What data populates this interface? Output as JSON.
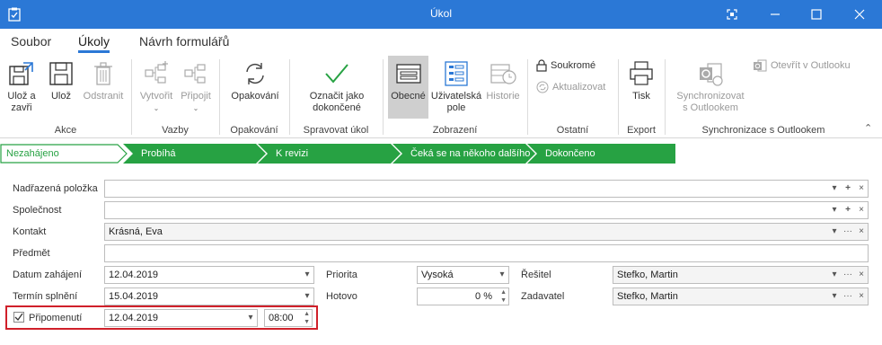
{
  "window": {
    "title": "Úkol",
    "buttons": [
      "focus-icon",
      "minimize-icon",
      "maximize-icon",
      "close-icon"
    ]
  },
  "tabs": [
    {
      "label": "Soubor",
      "active": false
    },
    {
      "label": "Úkoly",
      "active": true
    },
    {
      "label": "Návrh formulářů",
      "active": false
    }
  ],
  "ribbon": {
    "groups": {
      "akce": "Akce",
      "vazby": "Vazby",
      "opakovani": "Opakování",
      "spravovat": "Spravovat úkol",
      "zobrazeni": "Zobrazení",
      "ostatni": "Ostatní",
      "export": "Export",
      "sync": "Synchronizace s Outlookem"
    },
    "buttons": {
      "uloz_zavri_1": "Ulož a",
      "uloz_zavri_2": "zavři",
      "uloz": "Ulož",
      "odstranit": "Odstranit",
      "vytvorit": "Vytvořit",
      "pripojit": "Připojit",
      "opakovani": "Opakování",
      "oznacit_1": "Označit jako",
      "oznacit_2": "dokončené",
      "obecne": "Obecné",
      "uziv_1": "Uživatelská",
      "uziv_2": "pole",
      "historie": "Historie",
      "soukrome": "Soukromé",
      "aktualizovat": "Aktualizovat",
      "tisk": "Tisk",
      "sync_1": "Synchronizovat",
      "sync_2": "s Outlookem",
      "otevrit": "Otevřít v Outlooku"
    },
    "colors": {
      "accent": "#2b78d6",
      "disabled": "#9a9a9a"
    }
  },
  "stages": [
    {
      "label": "Nezahájeno",
      "current": true
    },
    {
      "label": "Probíhá",
      "current": false
    },
    {
      "label": "K revizi",
      "current": false
    },
    {
      "label": "Čeká se na někoho dalšího",
      "current": false
    },
    {
      "label": "Dokončeno",
      "current": false
    }
  ],
  "stage_colors": {
    "fill": "#27a243",
    "current_text": "#27a243"
  },
  "form": {
    "nadrazena_label": "Nadřazená položka",
    "nadrazena_value": "",
    "spolecnost_label": "Společnost",
    "spolecnost_value": "",
    "kontakt_label": "Kontakt",
    "kontakt_value": "Krásná, Eva",
    "predmet_label": "Předmět",
    "predmet_value": "",
    "datum_zahajeni_label": "Datum zahájení",
    "datum_zahajeni_value": "12.04.2019",
    "termin_label": "Termín splnění",
    "termin_value": "15.04.2019",
    "pripomenuti_label": "Připomenutí",
    "pripomenuti_checked": true,
    "pripomenuti_date": "12.04.2019",
    "pripomenuti_time": "08:00",
    "priorita_label": "Priorita",
    "priorita_value": "Vysoká",
    "hotovo_label": "Hotovo",
    "hotovo_value": "0 %",
    "resitel_label": "Řešitel",
    "resitel_value": "Stefko, Martin",
    "zadavatel_label": "Zadavatel",
    "zadavatel_value": "Stefko, Martin",
    "symbols": {
      "dropdown": "▾",
      "plus": "+",
      "clear": "×",
      "more": "···"
    }
  }
}
